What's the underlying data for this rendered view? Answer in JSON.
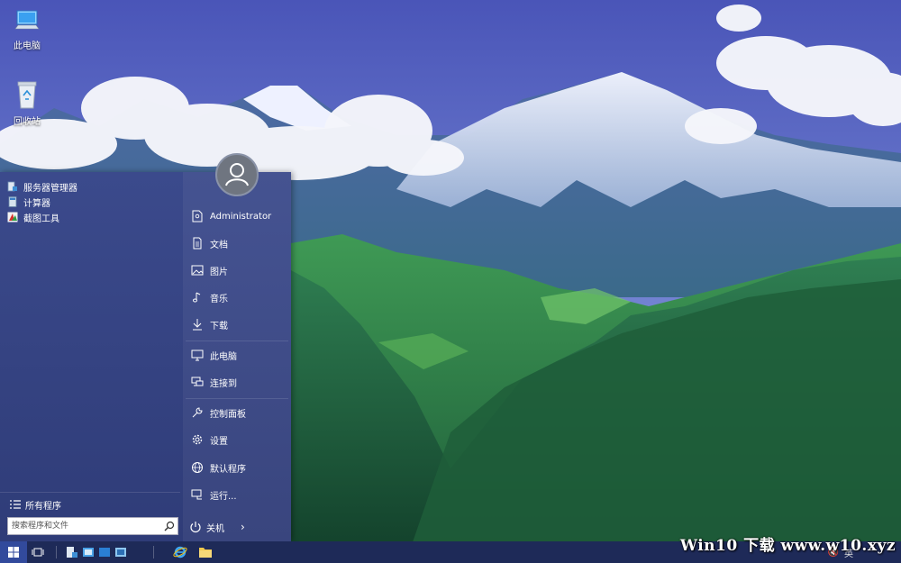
{
  "desktop": {
    "icons": [
      {
        "label": "此电脑",
        "icon": "computer-icon"
      },
      {
        "label": "回收站",
        "icon": "recycle-bin-icon"
      }
    ]
  },
  "start_menu": {
    "pinned": [
      {
        "label": "服务器管理器",
        "icon": "server-manager-icon"
      },
      {
        "label": "计算器",
        "icon": "calculator-icon"
      },
      {
        "label": "截图工具",
        "icon": "snipping-tool-icon"
      }
    ],
    "all_programs": "所有程序",
    "search_placeholder": "搜索程序和文件",
    "user": "Administrator",
    "right_items": [
      {
        "label": "文档",
        "icon": "document-icon"
      },
      {
        "label": "图片",
        "icon": "picture-icon"
      },
      {
        "label": "音乐",
        "icon": "music-icon"
      },
      {
        "label": "下载",
        "icon": "download-icon"
      },
      {
        "label": "此电脑",
        "icon": "computer-icon"
      },
      {
        "label": "连接到",
        "icon": "connect-icon"
      },
      {
        "label": "控制面板",
        "icon": "wrench-icon"
      },
      {
        "label": "设置",
        "icon": "gear-icon"
      },
      {
        "label": "默认程序",
        "icon": "globe-icon"
      },
      {
        "label": "运行...",
        "icon": "run-icon"
      }
    ],
    "power_label": "关机"
  },
  "taskbar": {
    "tray_language": "英"
  },
  "watermark": "Win10 下载 www.w10.xyz",
  "colors": {
    "start_menu_bg": "#34438a",
    "taskbar_bg": "#1e2a58",
    "start_button_bg": "#324a9c"
  }
}
